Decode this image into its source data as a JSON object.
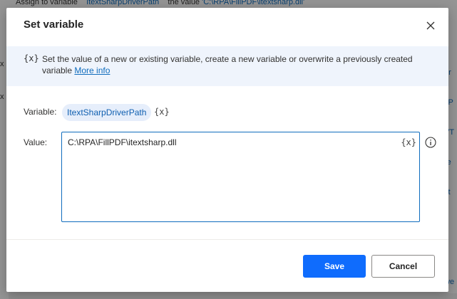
{
  "background": {
    "top_row_prefix": "Assign to variable",
    "top_row_variable": "ItextSharpDriverPath",
    "top_row_mid": "the value",
    "top_row_value": "'C:\\RPA\\FillPDF\\itextsharp.dll'",
    "left_items": [
      "x",
      "x"
    ],
    "right_items": [
      "ur",
      "vP",
      "VT",
      "re",
      "xt",
      "ff",
      "ff",
      "we"
    ]
  },
  "dialog": {
    "title": "Set variable",
    "close_icon": "close-icon",
    "banner": {
      "icon_text": "{x}",
      "description": "Set the value of a new or existing variable, create a new variable or overwrite a previously created variable",
      "more_info": "More info"
    },
    "variable_label": "Variable:",
    "variable_name": "ItextSharpDriverPath",
    "variable_icon_text": "{x}",
    "value_label": "Value:",
    "value_text": "C:\\RPA\\FillPDF\\itextsharp.dll",
    "value_icon_text": "{x}",
    "save_label": "Save",
    "cancel_label": "Cancel"
  },
  "colors": {
    "accent": "#0f6cfd",
    "banner_bg": "#eff4fc",
    "chip_bg": "#e6eefb"
  }
}
